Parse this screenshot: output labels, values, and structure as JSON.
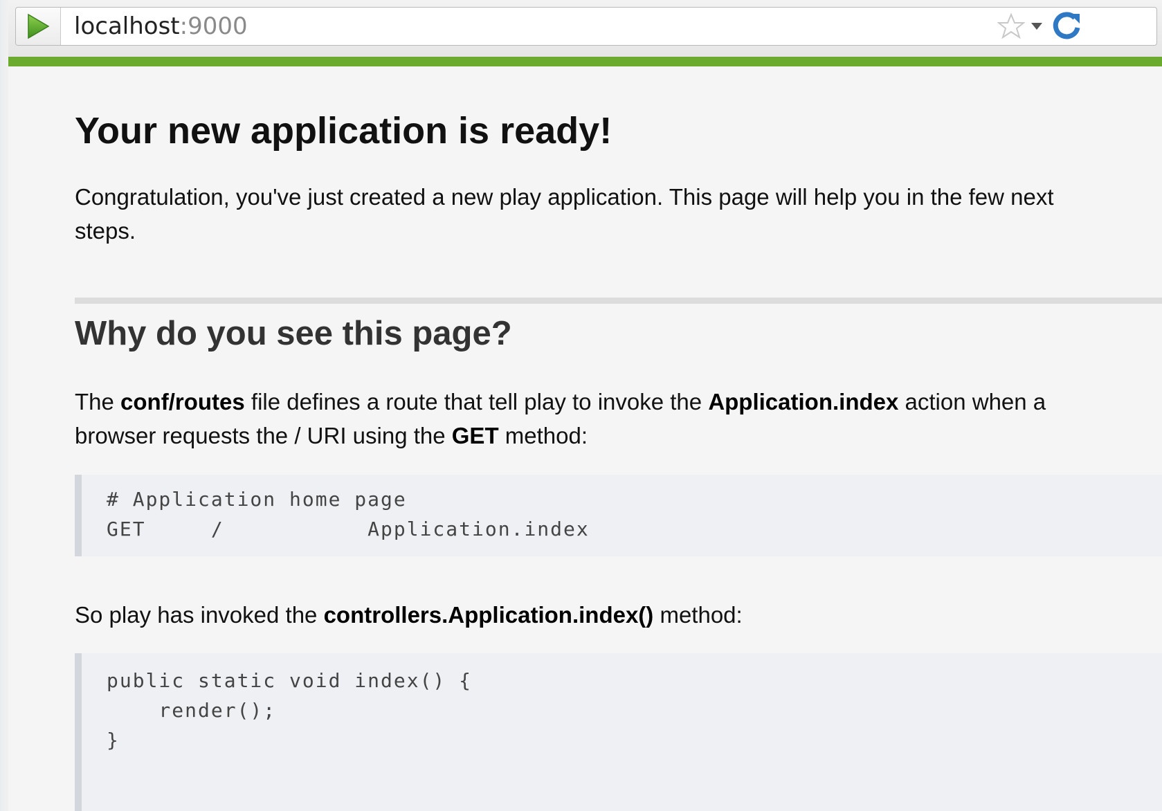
{
  "browser": {
    "url_host": "localhost",
    "url_port": ":9000",
    "icons": [
      "play-icon",
      "star-icon",
      "chevron-down-icon",
      "reload-icon"
    ],
    "accent_color": "#6aaa2c"
  },
  "page": {
    "title": "Your new application is ready!",
    "intro": "Congratulation, you've just created a new play application. This page will help you in the few next steps.",
    "section_title": "Why do you see this page?",
    "p1": {
      "t1": "The ",
      "b1": "conf/routes",
      "t2": " file defines a route that tell play to invoke the ",
      "b2": "Application.index",
      "t3": " action when a browser requests the / URI using the ",
      "b3": "GET",
      "t4": " method:"
    },
    "code_routes": "# Application home page\nGET     /           Application.index",
    "p2": {
      "t1": "So play has invoked the ",
      "b1": "controllers.Application.index()",
      "t2": " method:"
    },
    "code_controller": "public static void index() {\n    render();\n}"
  }
}
